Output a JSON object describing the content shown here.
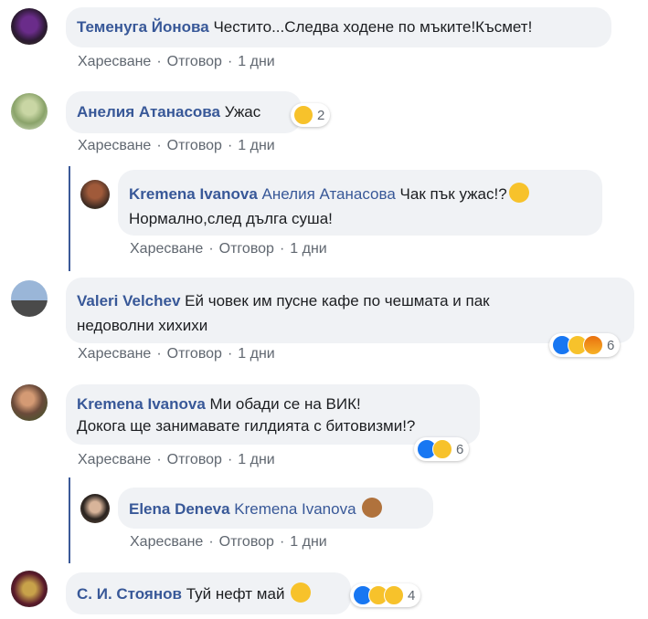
{
  "actions": {
    "like": "Харесване",
    "reply": "Отговор",
    "sep": "·"
  },
  "comments": [
    {
      "author": "Теменуга Йонова",
      "text": "Честито...Следва ходене по мъките!Късмет!",
      "time": "1 дни"
    },
    {
      "author": "Анелия Атанасова",
      "text": "Ужас",
      "time": "1 дни",
      "reactions": {
        "emojis": [
          "wow"
        ],
        "count": "2"
      }
    },
    {
      "author": "Kremena Ivanova",
      "mention": "Анелия Атанасова",
      "text_line1": "Чак пък ужас!?",
      "text_line2": "Нормално,след дълга суша!",
      "time": "1 дни"
    },
    {
      "author": "Valeri Velchev",
      "text_line1": "Ей човек им пусне кафе по чешмата и пак",
      "text_line2": "недоволни хихихи",
      "time": "1 дни",
      "reactions": {
        "emojis": [
          "like",
          "sad",
          "angry"
        ],
        "count": "6"
      }
    },
    {
      "author": "Kremena Ivanova",
      "text_line1": "Ми обади се на ВИК!",
      "text_line2": "Докога ще занимавате гилдията с битовизми!?",
      "time": "1 дни",
      "reactions": {
        "emojis": [
          "like",
          "wow"
        ],
        "count": "6"
      }
    },
    {
      "author": "Elena Deneva",
      "mention": "Kremena Ivanova",
      "time": "1 дни"
    },
    {
      "author": "С. И. Стоянов",
      "text": "Туй нефт май",
      "reactions": {
        "emojis": [
          "like",
          "haha",
          "sad"
        ],
        "count": "4"
      }
    }
  ],
  "colors": {
    "author": "#385898",
    "bubble": "#f0f2f5",
    "meta": "#606770",
    "thread_line": "#3b5998"
  }
}
